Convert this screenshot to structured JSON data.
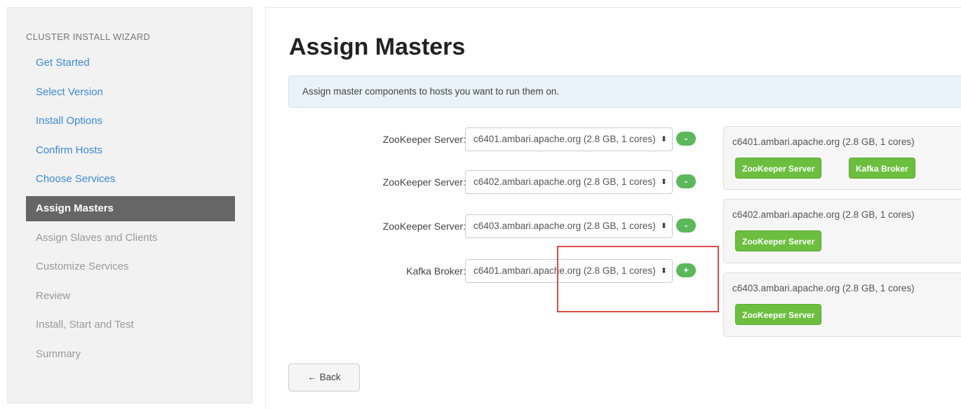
{
  "sidebar": {
    "title": "CLUSTER INSTALL WIZARD",
    "items": [
      {
        "label": "Get Started",
        "state": "done"
      },
      {
        "label": "Select Version",
        "state": "done"
      },
      {
        "label": "Install Options",
        "state": "done"
      },
      {
        "label": "Confirm Hosts",
        "state": "done"
      },
      {
        "label": "Choose Services",
        "state": "done"
      },
      {
        "label": "Assign Masters",
        "state": "active"
      },
      {
        "label": "Assign Slaves and Clients",
        "state": "pending"
      },
      {
        "label": "Customize Services",
        "state": "pending"
      },
      {
        "label": "Review",
        "state": "pending"
      },
      {
        "label": "Install, Start and Test",
        "state": "pending"
      },
      {
        "label": "Summary",
        "state": "pending"
      }
    ]
  },
  "main": {
    "title": "Assign Masters",
    "info": "Assign master components to hosts you want to run them on.",
    "assignments": [
      {
        "label": "ZooKeeper Server:",
        "host": "c6401.ambari.apache.org (2.8 GB, 1 cores)",
        "action": "-"
      },
      {
        "label": "ZooKeeper Server:",
        "host": "c6402.ambari.apache.org (2.8 GB, 1 cores)",
        "action": "-"
      },
      {
        "label": "ZooKeeper Server:",
        "host": "c6403.ambari.apache.org (2.8 GB, 1 cores)",
        "action": "-"
      },
      {
        "label": "Kafka Broker:",
        "host": "c6401.ambari.apache.org (2.8 GB, 1 cores)",
        "action": "+"
      }
    ],
    "select_arrows": "⬍",
    "hosts": [
      {
        "name": "c6401.ambari.apache.org (2.8 GB, 1 cores)",
        "components": [
          "ZooKeeper Server",
          "Kafka Broker"
        ]
      },
      {
        "name": "c6402.ambari.apache.org (2.8 GB, 1 cores)",
        "components": [
          "ZooKeeper Server"
        ]
      },
      {
        "name": "c6403.ambari.apache.org (2.8 GB, 1 cores)",
        "components": [
          "ZooKeeper Server"
        ]
      }
    ],
    "back_label": "← Back"
  },
  "colors": {
    "accent_link": "#3a8ad8",
    "active_nav": "#666666",
    "success": "#5cb85c",
    "badge": "#6cbf3e",
    "highlight": "#e04a4a"
  }
}
